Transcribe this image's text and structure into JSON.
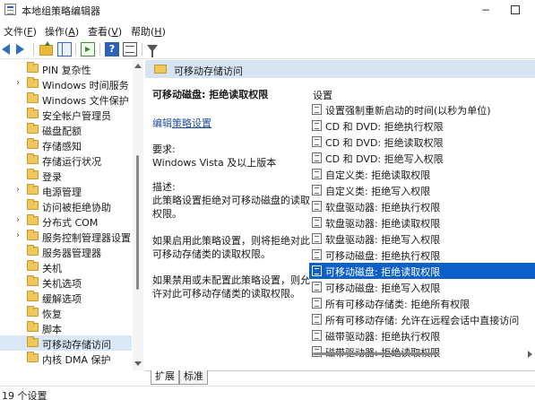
{
  "window": {
    "title": "本地组策略编辑器",
    "minimize_glyph": "−"
  },
  "menu": [
    {
      "label": "文件",
      "key": "F"
    },
    {
      "label": "操作",
      "key": "A"
    },
    {
      "label": "查看",
      "key": "V"
    },
    {
      "label": "帮助",
      "key": "H"
    }
  ],
  "toolbar": {
    "help_glyph": "?"
  },
  "tree": {
    "expander_glyph": "›",
    "items": [
      {
        "label": "PIN 复杂性",
        "expandable": false,
        "selected": false
      },
      {
        "label": "Windows 时间服务",
        "expandable": true,
        "selected": false
      },
      {
        "label": "Windows 文件保护",
        "expandable": false,
        "selected": false
      },
      {
        "label": "安全帐户管理员",
        "expandable": false,
        "selected": false
      },
      {
        "label": "磁盘配额",
        "expandable": false,
        "selected": false
      },
      {
        "label": "存储感知",
        "expandable": false,
        "selected": false
      },
      {
        "label": "存储运行状况",
        "expandable": false,
        "selected": false
      },
      {
        "label": "登录",
        "expandable": false,
        "selected": false
      },
      {
        "label": "电源管理",
        "expandable": true,
        "selected": false
      },
      {
        "label": "访问被拒绝协助",
        "expandable": false,
        "selected": false
      },
      {
        "label": "分布式 COM",
        "expandable": true,
        "selected": false
      },
      {
        "label": "服务控制管理器设置",
        "expandable": true,
        "selected": false
      },
      {
        "label": "服务器管理器",
        "expandable": false,
        "selected": false
      },
      {
        "label": "关机",
        "expandable": false,
        "selected": false
      },
      {
        "label": "关机选项",
        "expandable": false,
        "selected": false
      },
      {
        "label": "缓解选项",
        "expandable": false,
        "selected": false
      },
      {
        "label": "恢复",
        "expandable": false,
        "selected": false
      },
      {
        "label": "脚本",
        "expandable": false,
        "selected": false
      },
      {
        "label": "可移动存储访问",
        "expandable": false,
        "selected": true
      },
      {
        "label": "内核 DMA 保护",
        "expandable": false,
        "selected": false
      }
    ]
  },
  "header": {
    "title": "可移动存储访问"
  },
  "description": {
    "title": "可移动磁盘: 拒绝读取权限",
    "edit_prefix": "编辑",
    "edit_link": "策略设置",
    "requirements_label": "要求:",
    "requirements_value": "Windows Vista 及以上版本",
    "desc_label": "描述:",
    "desc_lines": [
      "此策略设置拒绝对可移动磁盘的读取",
      "权限。"
    ],
    "enabled_lines": [
      "如果启用此策略设置，则将拒绝对此",
      "可移动存储类的读取权限。"
    ],
    "disabled_lines": [
      "如果禁用或未配置此策略设置，则允",
      "许对此可移动存储类的读取权限。"
    ]
  },
  "settings": {
    "header": "设置",
    "items": [
      {
        "label": "设置强制重新启动的时间(以秒为单位)",
        "selected": false
      },
      {
        "label": "CD 和 DVD: 拒绝执行权限",
        "selected": false
      },
      {
        "label": "CD 和 DVD: 拒绝读取权限",
        "selected": false
      },
      {
        "label": "CD 和 DVD: 拒绝写入权限",
        "selected": false
      },
      {
        "label": "自定义类: 拒绝读取权限",
        "selected": false
      },
      {
        "label": "自定义类: 拒绝写入权限",
        "selected": false
      },
      {
        "label": "软盘驱动器: 拒绝执行权限",
        "selected": false
      },
      {
        "label": "软盘驱动器: 拒绝读取权限",
        "selected": false
      },
      {
        "label": "软盘驱动器: 拒绝写入权限",
        "selected": false
      },
      {
        "label": "可移动磁盘: 拒绝执行权限",
        "selected": false
      },
      {
        "label": "可移动磁盘: 拒绝读取权限",
        "selected": true
      },
      {
        "label": "可移动磁盘: 拒绝写入权限",
        "selected": false
      },
      {
        "label": "所有可移动存储类: 拒绝所有权限",
        "selected": false
      },
      {
        "label": "所有可移动存储: 允许在远程会话中直接访问",
        "selected": false
      },
      {
        "label": "磁带驱动器: 拒绝执行权限",
        "selected": false
      },
      {
        "label": "磁带驱动器: 拒绝读取权限",
        "selected": false
      }
    ]
  },
  "tabs": [
    {
      "label": "扩展",
      "active": true
    },
    {
      "label": "标准",
      "active": false
    }
  ],
  "status": {
    "text": "19 个设置"
  },
  "colors": {
    "selection": "#0b5fc9",
    "header_band": "#d5e3f3",
    "link": "#1f4f9e",
    "folder": "#f0c75e"
  }
}
